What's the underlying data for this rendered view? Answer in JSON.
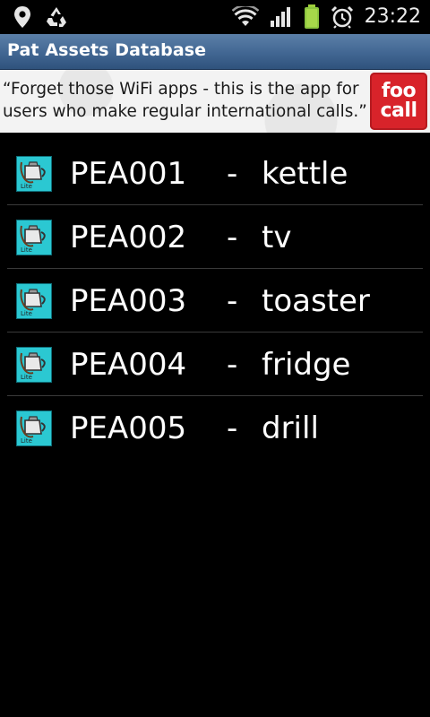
{
  "status_bar": {
    "time": "23:22",
    "icons_left": [
      "location-icon",
      "recycle-icon"
    ],
    "icons_right": [
      "wifi-icon",
      "signal-icon",
      "battery-icon",
      "alarm-icon"
    ]
  },
  "app": {
    "title": "Pat Assets Database"
  },
  "ad": {
    "line1": "“Forget those WiFi apps - this is the app for",
    "line2": "users who make regular international calls.”",
    "logo_top": "foo",
    "logo_bottom": "call",
    "logo_color": "#d8232a"
  },
  "assets": [
    {
      "code": "PEA001",
      "sep": "-",
      "name": "kettle"
    },
    {
      "code": "PEA002",
      "sep": "-",
      "name": "tv"
    },
    {
      "code": "PEA003",
      "sep": "-",
      "name": "toaster"
    },
    {
      "code": "PEA004",
      "sep": "-",
      "name": "fridge"
    },
    {
      "code": "PEA005",
      "sep": "-",
      "name": "drill"
    }
  ],
  "colors": {
    "title_bar": "#3f6490",
    "background": "#000000",
    "row_icon": "#29c9d4"
  }
}
